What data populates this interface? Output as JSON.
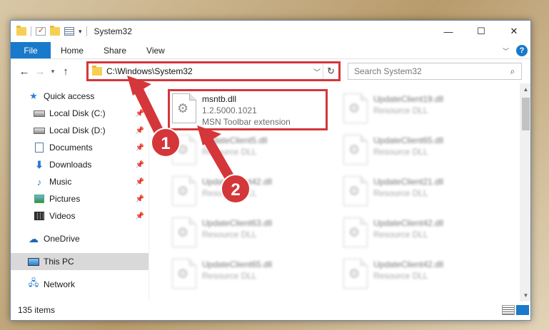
{
  "window": {
    "title": "System32"
  },
  "controls": {
    "minimize": "—",
    "maximize": "☐",
    "close": "✕"
  },
  "ribbon": {
    "tabs": [
      "File",
      "Home",
      "Share",
      "View"
    ],
    "help": "?"
  },
  "address": {
    "path": "C:\\Windows\\System32"
  },
  "search": {
    "placeholder": "Search System32"
  },
  "sidebar": {
    "quick_access": "Quick access",
    "items": [
      {
        "label": "Local Disk (C:)",
        "pinned": true
      },
      {
        "label": "Local Disk (D:)",
        "pinned": true
      },
      {
        "label": "Documents",
        "pinned": true
      },
      {
        "label": "Downloads",
        "pinned": true
      },
      {
        "label": "Music",
        "pinned": true
      },
      {
        "label": "Pictures",
        "pinned": true
      },
      {
        "label": "Videos",
        "pinned": true
      }
    ],
    "onedrive": "OneDrive",
    "this_pc": "This PC",
    "network": "Network"
  },
  "files": [
    {
      "name": "msntb.dll",
      "version": "1.2.5000.1021",
      "desc": "MSN Toolbar extension",
      "blurred": false
    },
    {
      "name": "UpdateClient19.dll",
      "version": "",
      "desc": "Resource DLL",
      "blurred": true
    },
    {
      "name": "UpdateClient5.dll",
      "version": "",
      "desc": "Resource DLL",
      "blurred": true
    },
    {
      "name": "UpdateClient65.dll",
      "version": "",
      "desc": "Resource DLL",
      "blurred": true
    },
    {
      "name": "UpdateClient42.dll",
      "version": "",
      "desc": "Resource DLL",
      "blurred": true
    },
    {
      "name": "UpdateClient21.dll",
      "version": "",
      "desc": "Resource DLL",
      "blurred": true
    },
    {
      "name": "UpdateClient63.dll",
      "version": "",
      "desc": "Resource DLL",
      "blurred": true
    },
    {
      "name": "UpdateClient42.dll",
      "version": "",
      "desc": "Resource DLL",
      "blurred": true
    },
    {
      "name": "UpdateClient65.dll",
      "version": "",
      "desc": "Resource DLL",
      "blurred": true
    },
    {
      "name": "UpdateClient42.dll",
      "version": "",
      "desc": "Resource DLL",
      "blurred": true
    }
  ],
  "annotations": {
    "step1": "1",
    "step2": "2",
    "color": "#d4363a"
  },
  "status": {
    "item_count": "135 items"
  }
}
